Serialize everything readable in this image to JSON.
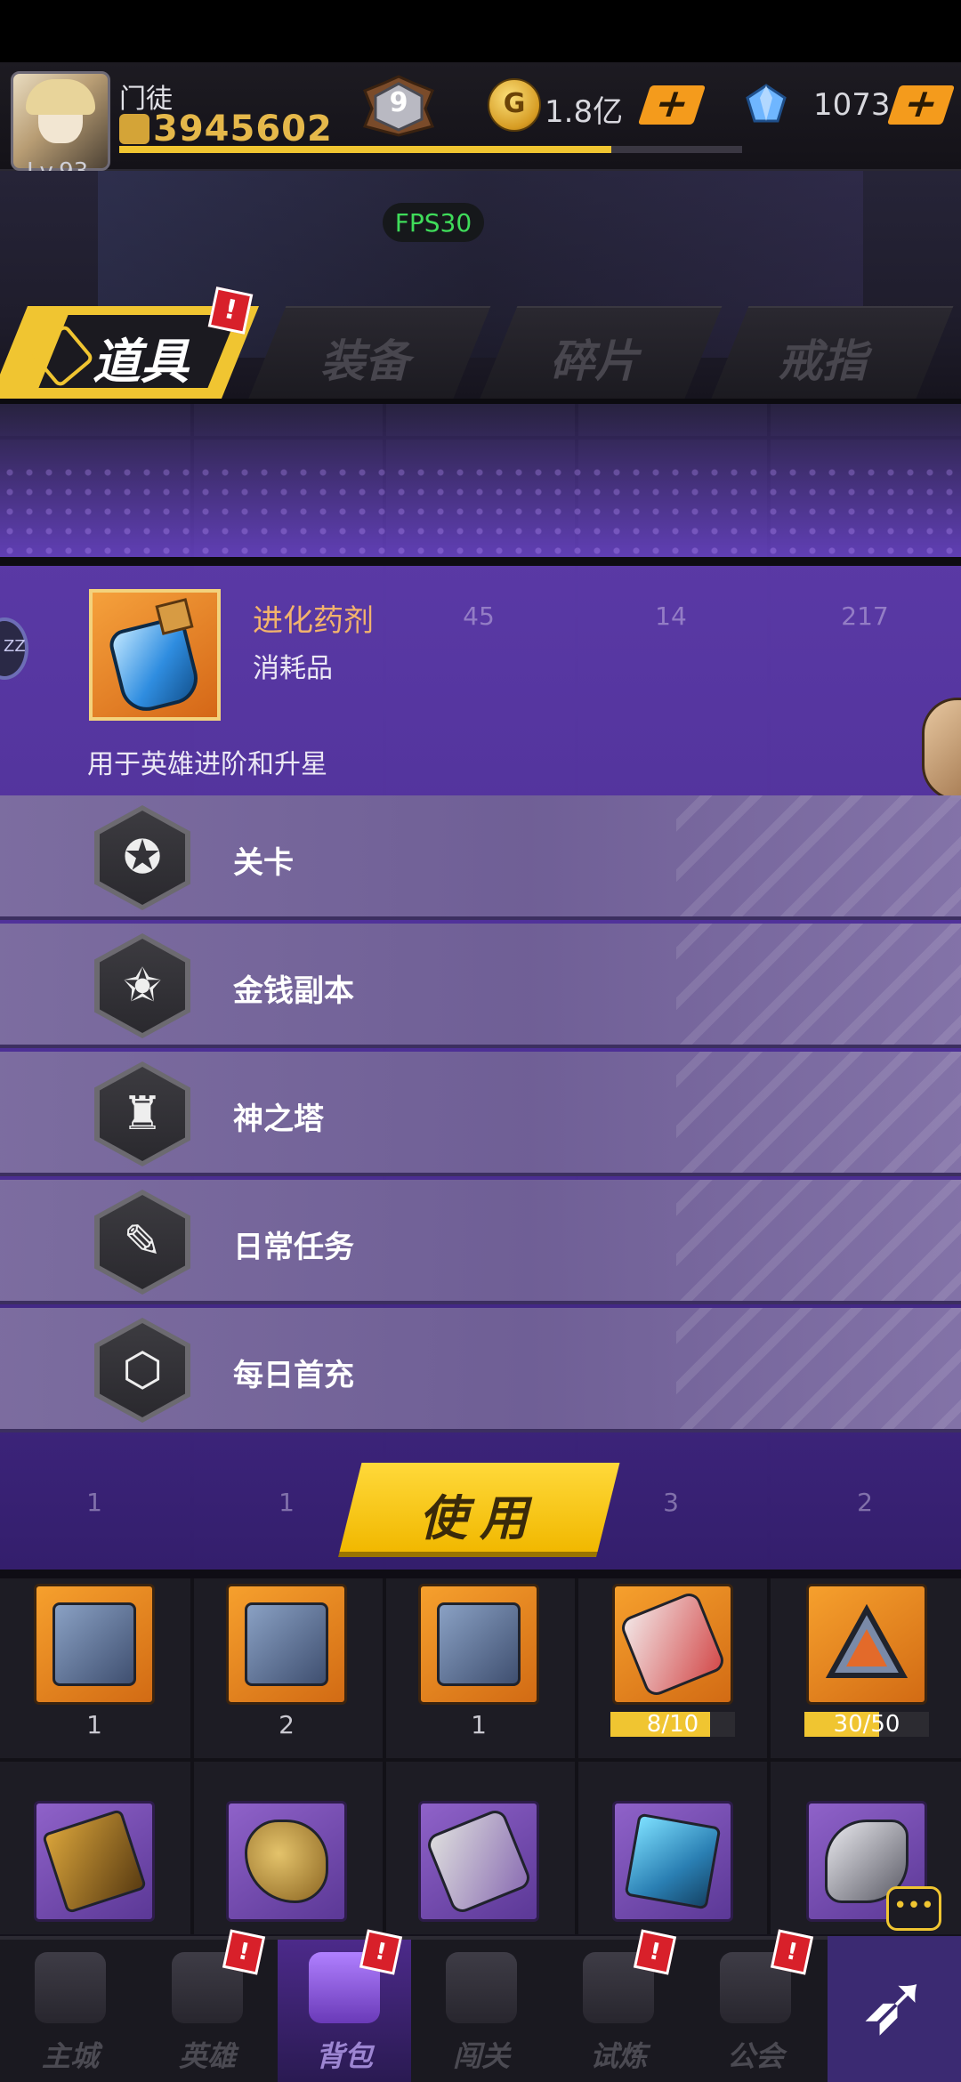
{
  "header": {
    "player_name": "门徒",
    "level": "Lv.93",
    "power": "3945602",
    "vip_level": "9",
    "coin_symbol": "G",
    "coins": "1.8亿",
    "gems": "1073",
    "add_symbol": "+",
    "xp_fraction": 0.79
  },
  "overlay": {
    "fps": "FPS30"
  },
  "tabs": [
    {
      "label": "道具",
      "active": true
    },
    {
      "label": "装备"
    },
    {
      "label": "碎片"
    },
    {
      "label": "戒指"
    }
  ],
  "alert_mark": "!",
  "popup": {
    "item_name": "进化药剂",
    "item_category": "消耗品",
    "item_description": "用于英雄进阶和升星",
    "side_marker": "ZZ",
    "sources": [
      {
        "label": "关卡",
        "icon": "medal-icon"
      },
      {
        "label": "金钱副本",
        "icon": "star-coin-icon"
      },
      {
        "label": "神之塔",
        "icon": "tower-icon"
      },
      {
        "label": "日常任务",
        "icon": "task-list-icon"
      },
      {
        "label": "每日首充",
        "icon": "recharge-icon"
      }
    ],
    "use_label": "使用"
  },
  "inventory": {
    "row_partial_counts": [
      "45",
      "14",
      "217"
    ],
    "row_below_counts": [
      "1",
      "1",
      "3",
      "2"
    ],
    "row_a": [
      {
        "count": "1"
      },
      {
        "count": "2"
      },
      {
        "count": "1"
      },
      {
        "progress": "8/10",
        "fraction": 0.8
      },
      {
        "progress": "30/50",
        "fraction": 0.6
      }
    ]
  },
  "bottom_nav": [
    {
      "label": "主城",
      "alert": false
    },
    {
      "label": "英雄",
      "alert": true
    },
    {
      "label": "背包",
      "alert": true,
      "active": true
    },
    {
      "label": "闯关",
      "alert": false
    },
    {
      "label": "试炼",
      "alert": true
    },
    {
      "label": "公会",
      "alert": true
    }
  ],
  "chat_icon_glyph": "•••",
  "colors": {
    "accent": "#f0c531",
    "popup_purple": "#5c3aaa",
    "alert_red": "#d8202a",
    "fps_green": "#3fdc5a"
  }
}
